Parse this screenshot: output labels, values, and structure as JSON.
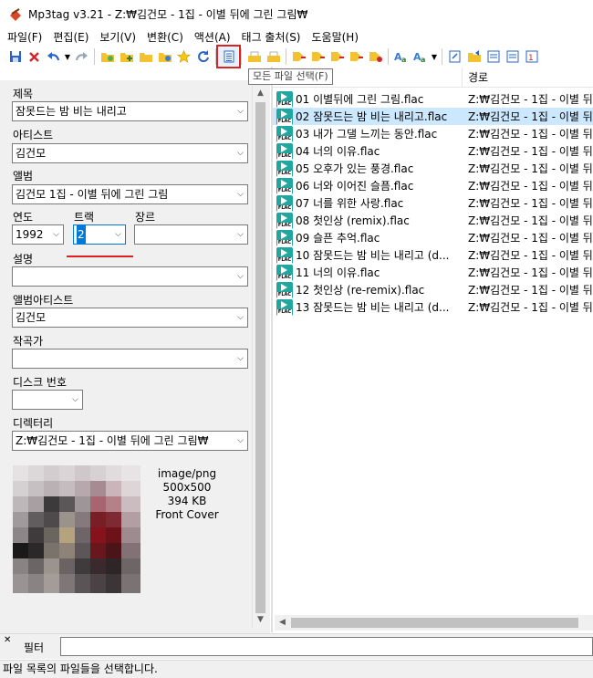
{
  "window": {
    "title": "Mp3tag v3.21  -  Z:₩김건모 - 1집 - 이별 뒤에 그린 그림₩"
  },
  "menu": [
    "파일(F)",
    "편집(E)",
    "보기(V)",
    "변환(C)",
    "액션(A)",
    "태그 출처(S)",
    "도움말(H)"
  ],
  "toolbar": {
    "tooltip": "모든 파일 선택(F)",
    "buttons": [
      "save-icon",
      "remove-tag-icon",
      "undo-icon",
      "dropdown-icon",
      "redo-icon",
      "change-directory-icon",
      "add-directory-icon",
      "open-folder-icon",
      "favorites-folder-icon",
      "favorite-star-icon",
      "refresh-icon",
      "select-all-files-icon",
      "export-icon",
      "print-icon",
      "tag-filename-icon",
      "filename-tag-icon",
      "text-file-tag-icon",
      "tag-tag-icon",
      "action-icon",
      "case-convert-icon",
      "case-dropdown-icon",
      "autonumber-icon",
      "web-source-icon",
      "web-source-2-icon",
      "info-icon"
    ]
  },
  "tagpanel": {
    "title_label": "제목",
    "title_value": "잠못드는 밤 비는 내리고",
    "artist_label": "아티스트",
    "artist_value": "김건모",
    "album_label": "앨범",
    "album_value": "김건모 1집 - 이별 뒤에 그린 그림",
    "year_label": "연도",
    "year_value": "1992",
    "track_label": "트랙",
    "track_value": "2",
    "genre_label": "장르",
    "genre_value": "",
    "comment_label": "설명",
    "comment_value": "",
    "albumartist_label": "앨범아티스트",
    "albumartist_value": "김건모",
    "composer_label": "작곡가",
    "composer_value": "",
    "discnumber_label": "디스크 번호",
    "discnumber_value": "",
    "directory_label": "디렉터리",
    "directory_value": "Z:₩김건모 - 1집 - 이별 뒤에 그린 그림₩",
    "cover": {
      "mime": "image/png",
      "size": "500x500",
      "filesize": "394 KB",
      "type": "Front Cover"
    }
  },
  "filelist": {
    "header_path": "경로",
    "files": [
      {
        "name": "01 이별뒤에 그린 그림.flac",
        "path": "Z:₩김건모 - 1집 - 이별 뒤"
      },
      {
        "name": "02 잠못드는 밤 비는 내리고.flac",
        "path": "Z:₩김건모 - 1집 - 이별 뒤"
      },
      {
        "name": "03 내가 그댈 느끼는 동안.flac",
        "path": "Z:₩김건모 - 1집 - 이별 뒤"
      },
      {
        "name": "04 너의 이유.flac",
        "path": "Z:₩김건모 - 1집 - 이별 뒤"
      },
      {
        "name": "05 오후가 있는 풍경.flac",
        "path": "Z:₩김건모 - 1집 - 이별 뒤"
      },
      {
        "name": "06 너와 이어진 슬픔.flac",
        "path": "Z:₩김건모 - 1집 - 이별 뒤"
      },
      {
        "name": "07 너를 위한 사랑.flac",
        "path": "Z:₩김건모 - 1집 - 이별 뒤"
      },
      {
        "name": "08 첫인상 (remix).flac",
        "path": "Z:₩김건모 - 1집 - 이별 뒤"
      },
      {
        "name": "09 슬픈 추억.flac",
        "path": "Z:₩김건모 - 1집 - 이별 뒤"
      },
      {
        "name": "10 잠못드는 밤 비는 내리고 (d...",
        "path": "Z:₩김건모 - 1집 - 이별 뒤"
      },
      {
        "name": "11 너의 이유.flac",
        "path": "Z:₩김건모 - 1집 - 이별 뒤"
      },
      {
        "name": "12 첫인상 (re-remix).flac",
        "path": "Z:₩김건모 - 1집 - 이별 뒤"
      },
      {
        "name": "13 잠못드는 밤 비는 내리고 (d...",
        "path": "Z:₩김건모 - 1집 - 이별 뒤"
      }
    ],
    "selected_index": 1,
    "icon_label": "FLAC"
  },
  "filter": {
    "label": "필터",
    "value": ""
  },
  "status": {
    "text": "파일 목록의 파일들을 선택합니다."
  },
  "colors": {
    "selection": "#cce8ff",
    "highlight": "#e02020",
    "flac_icon": "#1fa7a0"
  }
}
